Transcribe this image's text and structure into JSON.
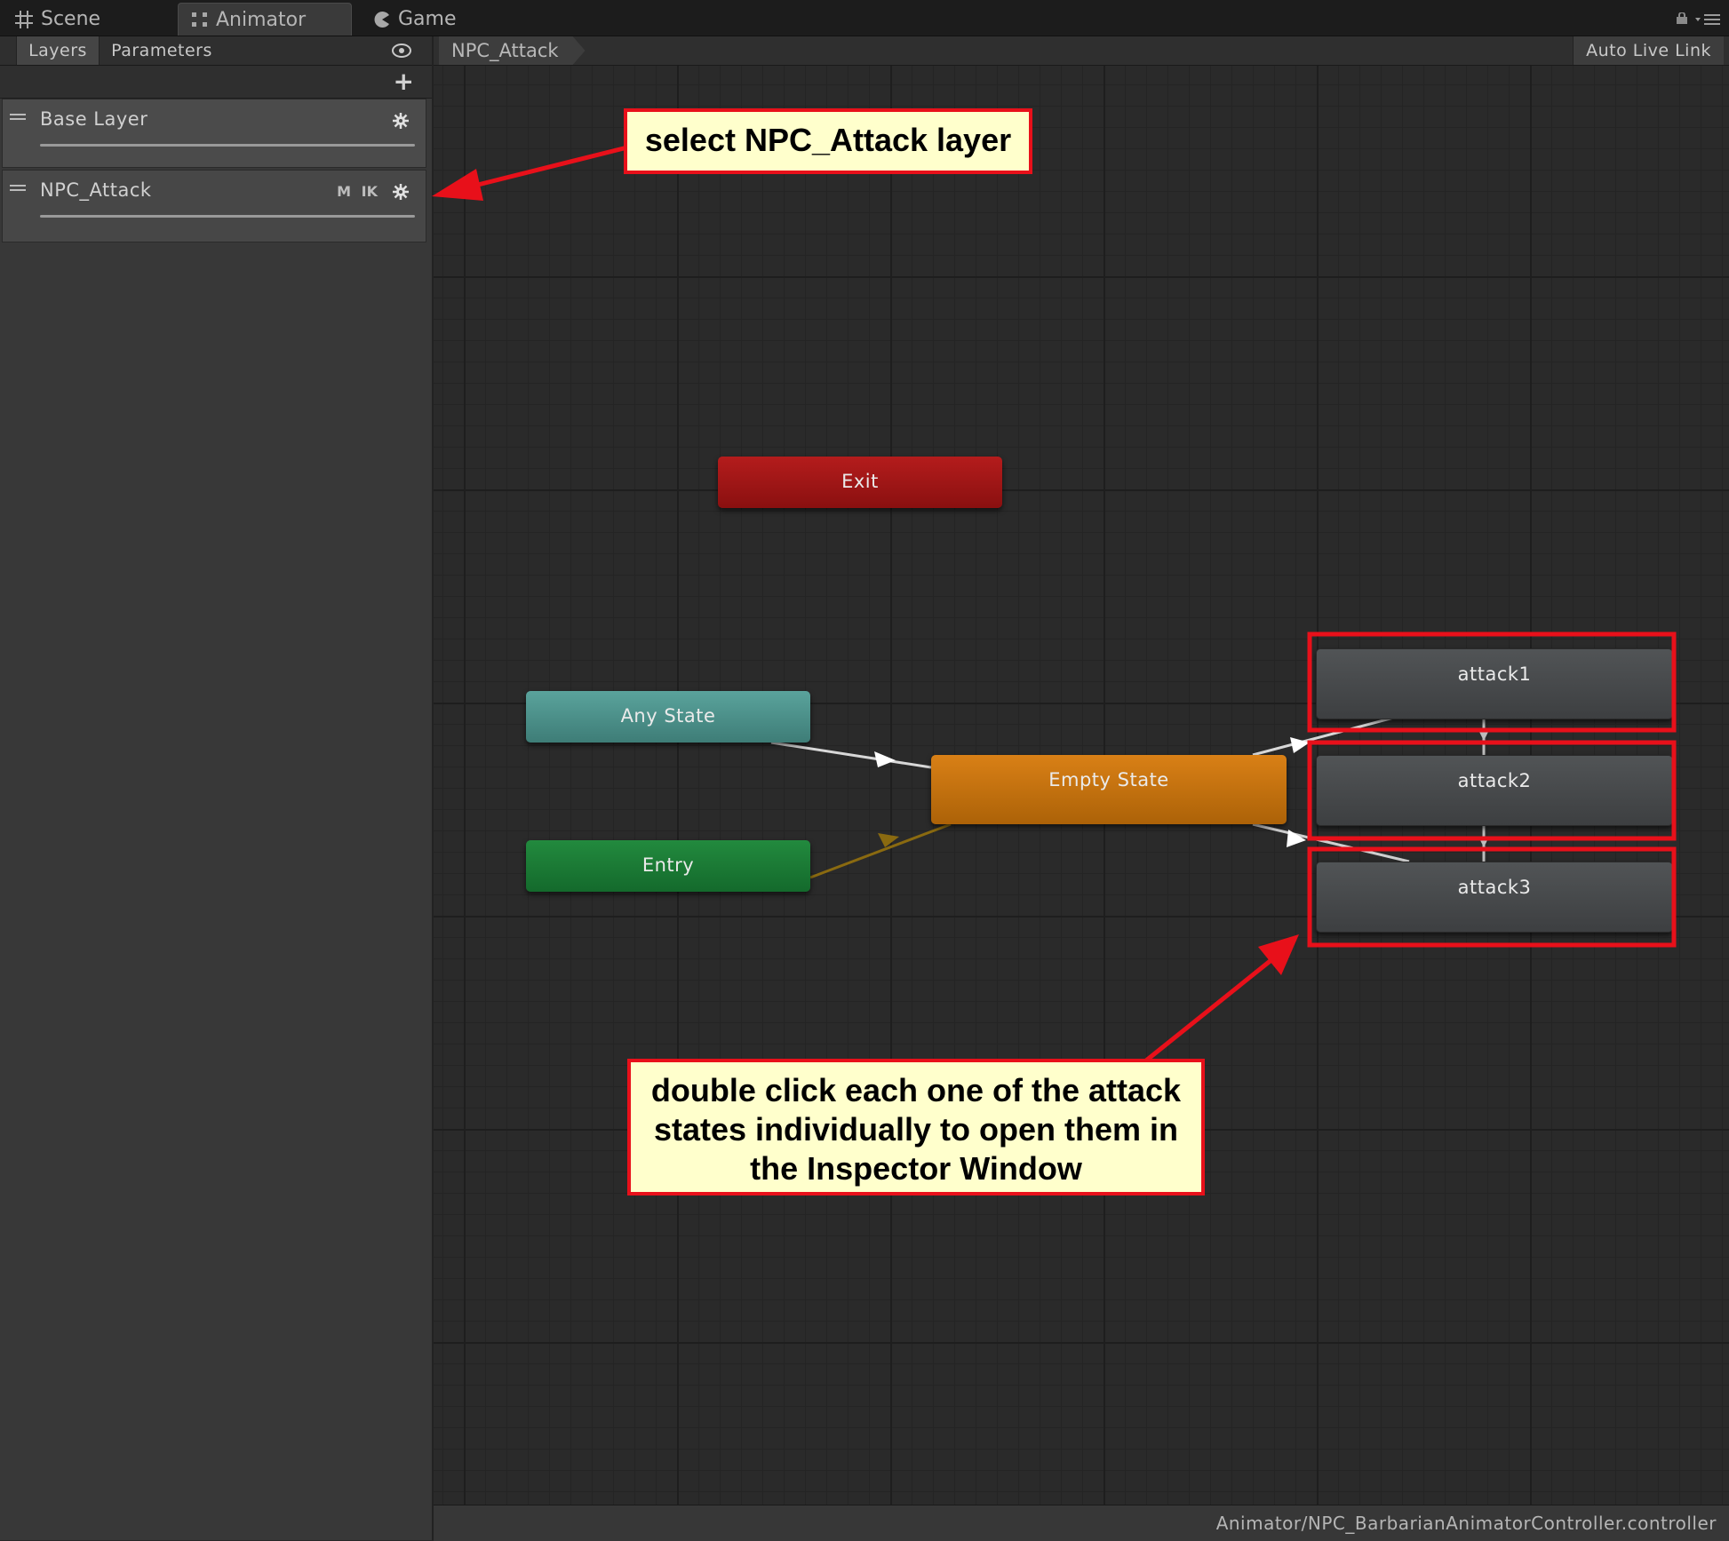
{
  "tabs": [
    {
      "label": "Scene",
      "icon": "grid-icon"
    },
    {
      "label": "Animator",
      "icon": "animator-icon",
      "active": true
    },
    {
      "label": "Game",
      "icon": "pacman-icon"
    }
  ],
  "left_panel": {
    "tabs": {
      "layers": "Layers",
      "parameters": "Parameters"
    },
    "layers": [
      {
        "name": "Base Layer",
        "badges": []
      },
      {
        "name": "NPC_Attack",
        "badges": {
          "m": "M",
          "ik": "IK"
        }
      }
    ]
  },
  "graph": {
    "breadcrumb": "NPC_Attack",
    "auto_live_link": "Auto Live Link",
    "states": {
      "exit": "Exit",
      "any_state": "Any State",
      "entry": "Entry",
      "empty_state": "Empty State",
      "attack1": "attack1",
      "attack2": "attack2",
      "attack3": "attack3"
    }
  },
  "status_bar": {
    "path": "Animator/NPC_BarbarianAnimatorController.controller"
  },
  "annotations": {
    "callout1": "select NPC_Attack layer",
    "callout2_line1": "double click each one of the attack",
    "callout2_line2": "states individually to open them in",
    "callout2_line3": "the Inspector Window"
  },
  "colors": {
    "exit": "#b41c1c",
    "any_state": "#5aa39c",
    "entry": "#228a3e",
    "empty_state": "#d98016",
    "attack": "#4a4d50",
    "annotation_red": "#e8101a",
    "annotation_bg": "#ffffcc"
  }
}
